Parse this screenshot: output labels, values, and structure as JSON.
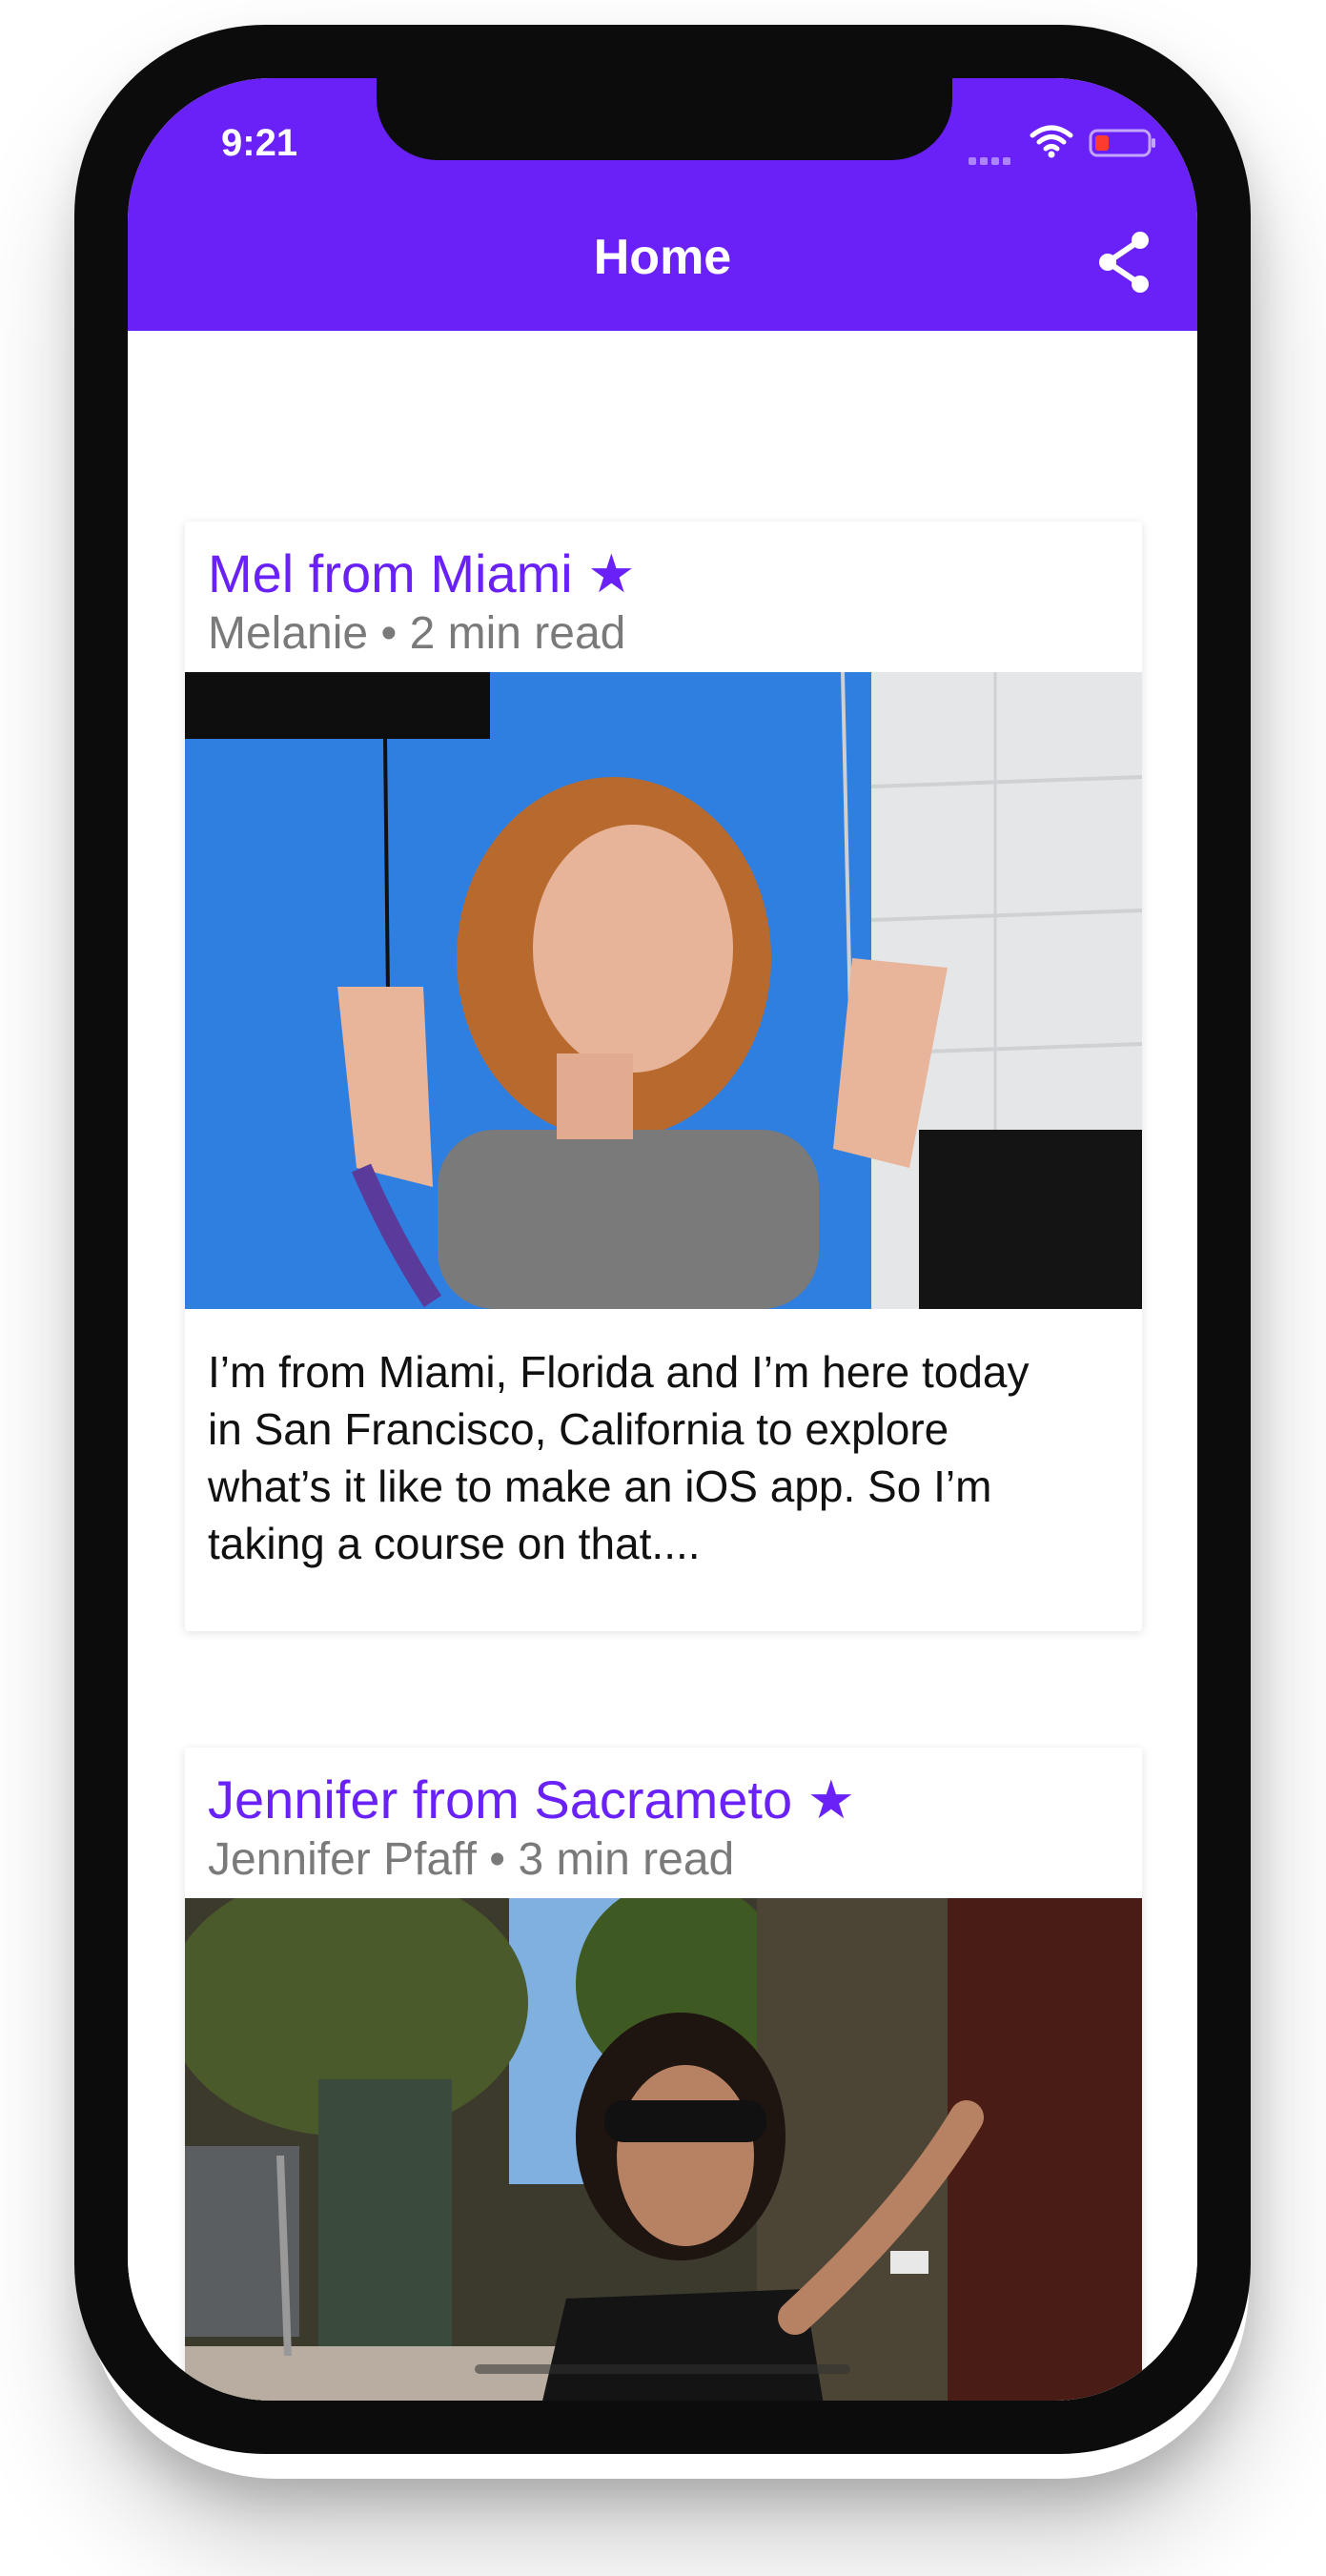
{
  "status_bar": {
    "time": "9:21"
  },
  "header": {
    "title": "Home",
    "share_icon": "share-icon",
    "background": "#6a21f7"
  },
  "cards": [
    {
      "title": "Mel from Miami",
      "star": "★",
      "author": "Melanie",
      "read_time": "2 min read",
      "excerpt": "I’m from Miami, Florida and I’m here today in San Francisco, California to explore what’s it like to make an iOS app. So I’m taking a course on that...."
    },
    {
      "title": "Jennifer from Sacrameto",
      "star": "★",
      "author": "Jennifer Pfaff",
      "read_time": "3 min read"
    }
  ],
  "colors": {
    "accent": "#6a21f7",
    "meta_text": "#7a7a7a",
    "battery_low": "#ff3b30"
  }
}
